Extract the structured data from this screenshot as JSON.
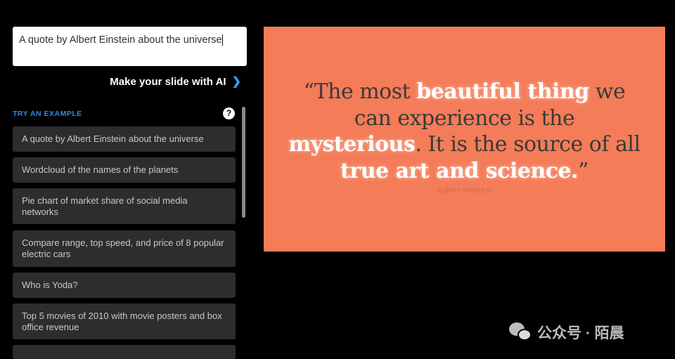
{
  "prompt": {
    "value": "A quote by Albert Einstein about the universe"
  },
  "make_button": {
    "label": "Make your slide with AI",
    "icon": "chevron-right-icon"
  },
  "examples": {
    "heading": "TRY AN EXAMPLE",
    "help_icon": "?",
    "items": [
      {
        "label": "A quote by Albert Einstein about the universe"
      },
      {
        "label": "Wordcloud of the names of the planets"
      },
      {
        "label": "Pie chart of market share of social media networks"
      },
      {
        "label": "Compare range, top speed, and price of 8 popular electric cars"
      },
      {
        "label": "Who is Yoda?"
      },
      {
        "label": "Top 5 movies of 2010 with movie posters and box office revenue"
      }
    ]
  },
  "slide": {
    "background": "#f47c58",
    "segments": [
      {
        "text": "“The most ",
        "highlight": false
      },
      {
        "text": "beautiful thing",
        "highlight": true
      },
      {
        "text": " we can experience is the ",
        "highlight": false
      },
      {
        "text": "mysterious",
        "highlight": true
      },
      {
        "text": ". It is the source of all ",
        "highlight": false
      },
      {
        "text": "true art and science.",
        "highlight": true
      },
      {
        "text": "”",
        "highlight": false
      }
    ],
    "author": "ALBERT EINSTEIN"
  },
  "watermark": {
    "text": "公众号 · 陌晨",
    "icon": "wechat-icon"
  }
}
